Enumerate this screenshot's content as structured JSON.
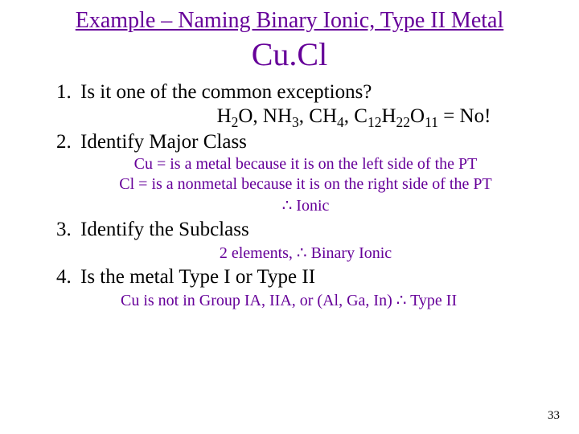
{
  "title": "Example – Naming Binary Ionic, Type II Metal",
  "compound": "Cu.Cl",
  "items": {
    "n1": "1.",
    "q1": "Is it one of the common exceptions?",
    "exceptions_prefix": "H",
    "exceptions_mid1": "O, NH",
    "exceptions_mid2": ", CH",
    "exceptions_mid3": ", C",
    "exceptions_mid4": "H",
    "exceptions_mid5": "O",
    "exceptions_tail": " = No!",
    "n2": "2.",
    "q2": "Identify Major Class",
    "d2a": "Cu = is a metal because it is on the left side of the PT",
    "d2b": "Cl = is a nonmetal because it is on the right side of the PT",
    "d2c": "∴ Ionic",
    "n3": "3.",
    "q3": "Identify the Subclass",
    "d3": "2 elements, ∴ Binary Ionic",
    "n4": "4.",
    "q4": "Is the metal Type I or Type II",
    "d4": "Cu is not in Group IA, IIA, or (Al, Ga, In) ∴ Type II"
  },
  "sub": {
    "s2": "2",
    "s3": "3",
    "s4": "4",
    "s11": "11",
    "s12": "12",
    "s22": "22"
  },
  "page": "33"
}
